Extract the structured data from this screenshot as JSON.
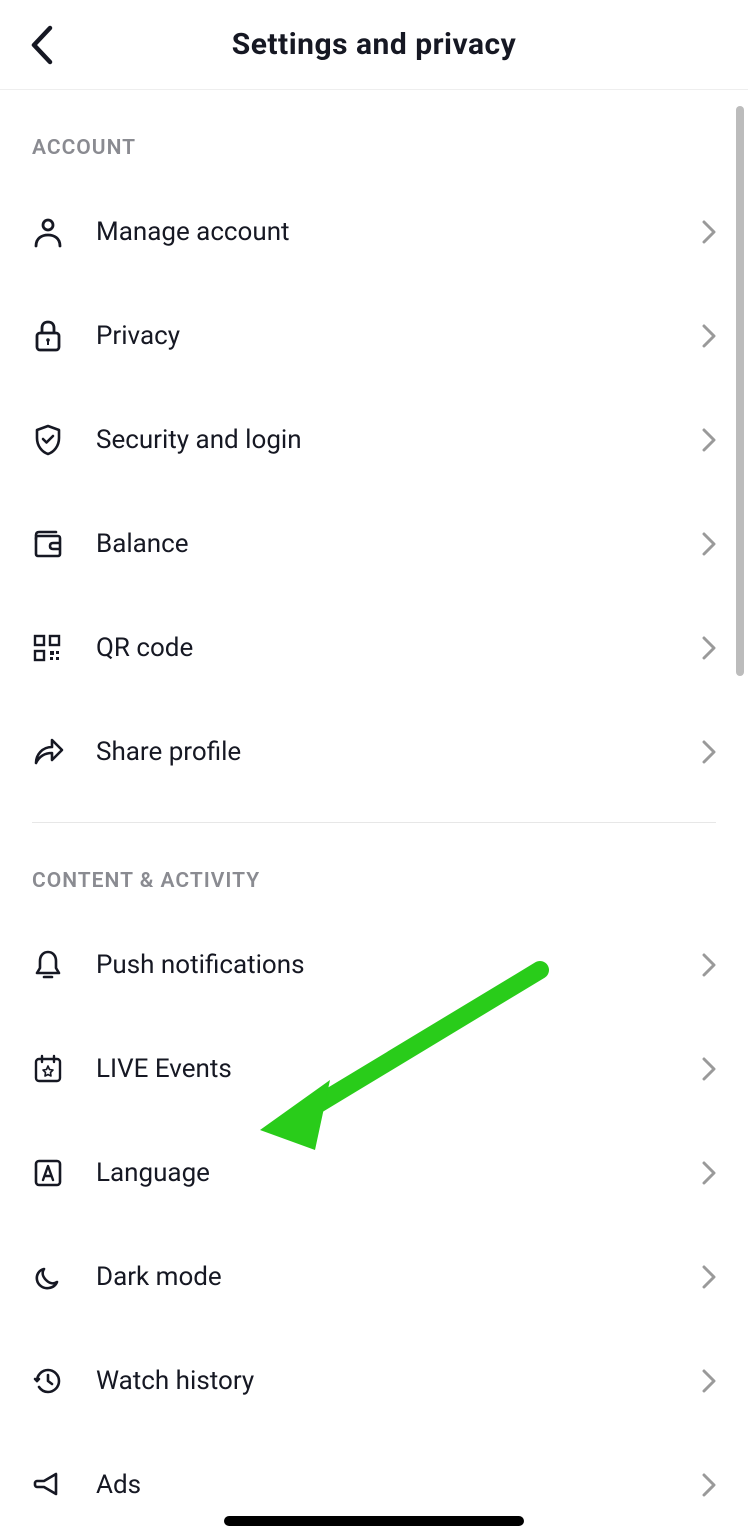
{
  "header": {
    "title": "Settings and privacy"
  },
  "sections": {
    "account": {
      "header": "ACCOUNT",
      "items": {
        "manage_account": "Manage account",
        "privacy": "Privacy",
        "security": "Security and login",
        "balance": "Balance",
        "qr_code": "QR code",
        "share_profile": "Share profile"
      }
    },
    "content_activity": {
      "header": "CONTENT & ACTIVITY",
      "items": {
        "push_notifications": "Push notifications",
        "live_events": "LIVE Events",
        "language": "Language",
        "dark_mode": "Dark mode",
        "watch_history": "Watch history",
        "ads": "Ads"
      }
    }
  },
  "annotation": {
    "arrow_color": "#29cc1a",
    "target": "language"
  }
}
